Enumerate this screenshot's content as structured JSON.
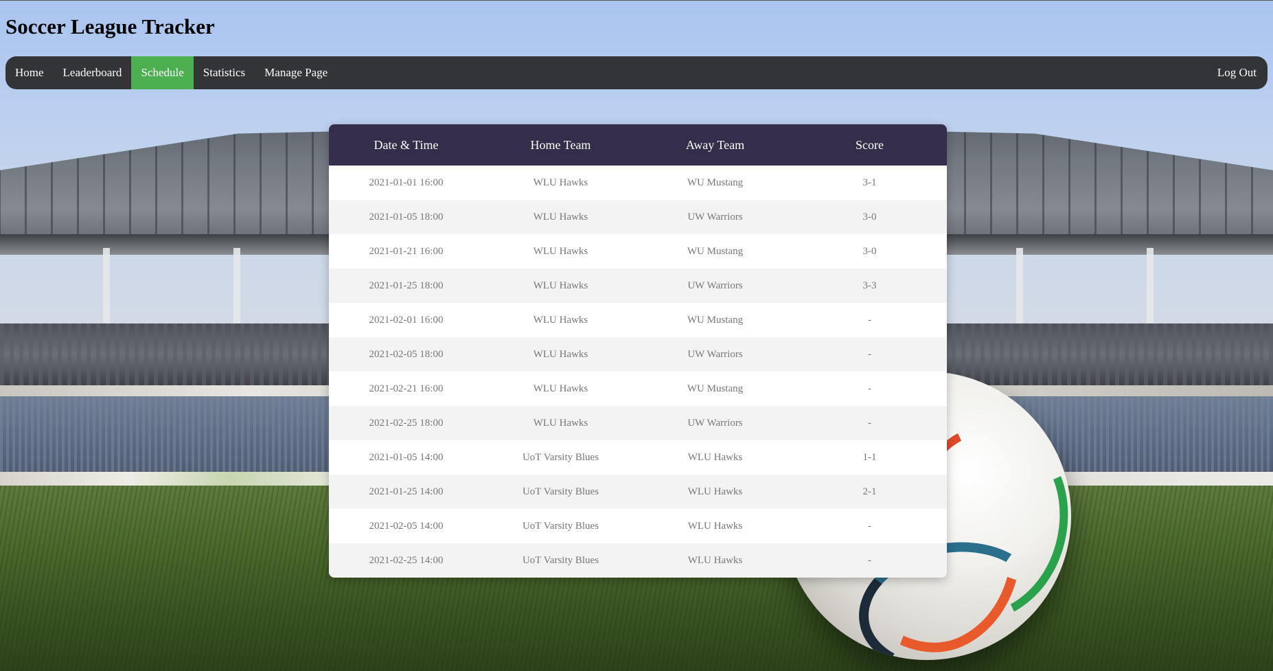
{
  "site": {
    "title": "Soccer League Tracker"
  },
  "nav": {
    "items": [
      {
        "label": "Home",
        "active": false
      },
      {
        "label": "Leaderboard",
        "active": false
      },
      {
        "label": "Schedule",
        "active": true
      },
      {
        "label": "Statistics",
        "active": false
      },
      {
        "label": "Manage Page",
        "active": false
      }
    ],
    "logout_label": "Log Out"
  },
  "schedule": {
    "headers": [
      "Date & Time",
      "Home Team",
      "Away Team",
      "Score"
    ],
    "rows": [
      [
        "2021-01-01 16:00",
        "WLU Hawks",
        "WU Mustang",
        "3-1"
      ],
      [
        "2021-01-05 18:00",
        "WLU Hawks",
        "UW Warriors",
        "3-0"
      ],
      [
        "2021-01-21 16:00",
        "WLU Hawks",
        "WU Mustang",
        "3-0"
      ],
      [
        "2021-01-25 18:00",
        "WLU Hawks",
        "UW Warriors",
        "3-3"
      ],
      [
        "2021-02-01 16:00",
        "WLU Hawks",
        "WU Mustang",
        "-"
      ],
      [
        "2021-02-05 18:00",
        "WLU Hawks",
        "UW Warriors",
        "-"
      ],
      [
        "2021-02-21 16:00",
        "WLU Hawks",
        "WU Mustang",
        "-"
      ],
      [
        "2021-02-25 18:00",
        "WLU Hawks",
        "UW Warriors",
        "-"
      ],
      [
        "2021-01-05 14:00",
        "UoT Varsity Blues",
        "WLU Hawks",
        "1-1"
      ],
      [
        "2021-01-25 14:00",
        "UoT Varsity Blues",
        "WLU Hawks",
        "2-1"
      ],
      [
        "2021-02-05 14:00",
        "UoT Varsity Blues",
        "WLU Hawks",
        "-"
      ],
      [
        "2021-02-25 14:00",
        "UoT Varsity Blues",
        "WLU Hawks",
        "-"
      ]
    ]
  },
  "colors": {
    "navbar_bg": "#333438",
    "nav_active": "#4caf50",
    "table_header_bg": "#342e4b",
    "cell_text": "#777777"
  }
}
